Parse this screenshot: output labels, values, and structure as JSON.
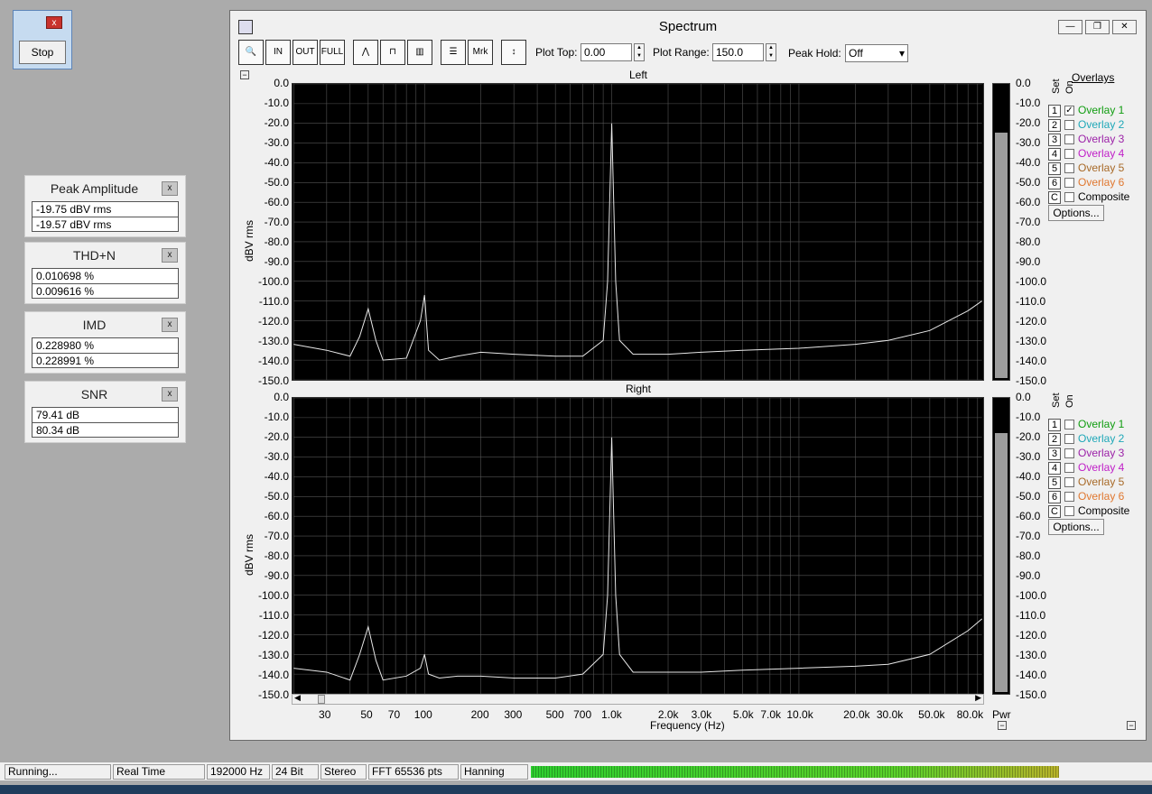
{
  "stop_window": {
    "button": "Stop",
    "close": "x"
  },
  "meters": [
    {
      "title": "Peak Amplitude",
      "values": [
        "-19.75 dBV rms",
        "-19.57 dBV rms"
      ]
    },
    {
      "title": "THD+N",
      "values": [
        "0.010698 %",
        "0.009616 %"
      ]
    },
    {
      "title": "IMD",
      "values": [
        "0.228980 %",
        "0.228991 %"
      ]
    },
    {
      "title": "SNR",
      "values": [
        "79.41 dB",
        "80.34 dB"
      ]
    }
  ],
  "spectrum": {
    "title": "Spectrum",
    "plot_top_label": "Plot Top:",
    "plot_top": "0.00",
    "plot_range_label": "Plot Range:",
    "plot_range": "150.0",
    "peak_hold_label": "Peak Hold:",
    "peak_hold": "Off",
    "marker_label": "Mrk",
    "left_title": "Left",
    "right_title": "Right",
    "y_unit": "dBV rms",
    "x_unit": "Frequency (Hz)",
    "pwr_label": "Pwr",
    "overlays_title": "Overlays",
    "set_label": "Set",
    "on_label": "On",
    "options_label": "Options...",
    "overlays": [
      {
        "set": "1",
        "label": "Overlay 1",
        "color": "#109d10"
      },
      {
        "set": "2",
        "label": "Overlay 2",
        "color": "#1fa8b8"
      },
      {
        "set": "3",
        "label": "Overlay 3",
        "color": "#9c22a8"
      },
      {
        "set": "4",
        "label": "Overlay 4",
        "color": "#c020c8"
      },
      {
        "set": "5",
        "label": "Overlay 5",
        "color": "#a86a28"
      },
      {
        "set": "6",
        "label": "Overlay 6",
        "color": "#e07830"
      },
      {
        "set": "C",
        "label": "Composite",
        "color": "#000000"
      }
    ],
    "left_overlay1_checked": true,
    "y_ticks": [
      "0.0",
      "-10.0",
      "-20.0",
      "-30.0",
      "-40.0",
      "-50.0",
      "-60.0",
      "-70.0",
      "-80.0",
      "-90.0",
      "-100.0",
      "-110.0",
      "-120.0",
      "-130.0",
      "-140.0",
      "-150.0"
    ],
    "x_ticks": [
      "30",
      "50",
      "70",
      "100",
      "200",
      "300",
      "500",
      "700",
      "1.0k",
      "2.0k",
      "3.0k",
      "5.0k",
      "7.0k",
      "10.0k",
      "20.0k",
      "30.0k",
      "50.0k",
      "80.0k"
    ],
    "pwr_level_left": -25,
    "pwr_level_right": -18
  },
  "chart_data": [
    {
      "type": "line",
      "title": "Left",
      "xlabel": "Frequency (Hz)",
      "ylabel": "dBV rms",
      "xscale": "log",
      "xlim": [
        20,
        95000
      ],
      "ylim": [
        -150,
        0
      ],
      "grid": true,
      "x": [
        20,
        30,
        40,
        45,
        50,
        55,
        60,
        80,
        95,
        100,
        105,
        120,
        150,
        200,
        300,
        500,
        700,
        900,
        950,
        1000,
        1050,
        1100,
        1300,
        2000,
        3000,
        5000,
        10000,
        20000,
        30000,
        50000,
        80000,
        95000
      ],
      "y": [
        -132,
        -135,
        -138,
        -128,
        -114,
        -130,
        -140,
        -139,
        -120,
        -107,
        -135,
        -140,
        -138,
        -136,
        -137,
        -138,
        -138,
        -130,
        -100,
        -20,
        -100,
        -130,
        -137,
        -137,
        -136,
        -135,
        -134,
        -132,
        -130,
        -125,
        -115,
        -110
      ]
    },
    {
      "type": "line",
      "title": "Right",
      "xlabel": "Frequency (Hz)",
      "ylabel": "dBV rms",
      "xscale": "log",
      "xlim": [
        20,
        95000
      ],
      "ylim": [
        -150,
        0
      ],
      "grid": true,
      "x": [
        20,
        30,
        40,
        45,
        50,
        55,
        60,
        80,
        95,
        100,
        105,
        120,
        150,
        200,
        300,
        500,
        700,
        900,
        950,
        1000,
        1050,
        1100,
        1300,
        2000,
        3000,
        5000,
        10000,
        20000,
        30000,
        50000,
        80000,
        95000
      ],
      "y": [
        -137,
        -139,
        -143,
        -130,
        -116,
        -133,
        -143,
        -141,
        -137,
        -130,
        -140,
        -142,
        -141,
        -141,
        -142,
        -142,
        -140,
        -130,
        -100,
        -20,
        -100,
        -130,
        -139,
        -139,
        -139,
        -138,
        -137,
        -136,
        -135,
        -130,
        -118,
        -112
      ]
    }
  ],
  "status": {
    "items": [
      "Running...",
      "Real Time",
      "192000 Hz",
      "24 Bit",
      "Stereo",
      "FFT 65536 pts",
      "Hanning"
    ]
  }
}
